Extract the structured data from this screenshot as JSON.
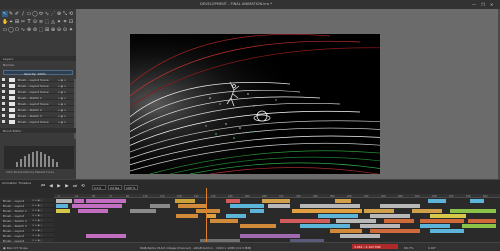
{
  "window": {
    "title": "DEVELOPMENT - FINAL ANIMATION.kra *",
    "controls": [
      "—",
      "❐",
      "✕"
    ]
  },
  "toolbox": {
    "rows": [
      [
        "↖",
        "✎",
        "✐",
        "∕",
        "▭",
        "◯",
        "⬭",
        "∿",
        "⋰",
        "⊕",
        "⤡",
        "⟲"
      ],
      [
        "✋",
        "⌖",
        "⊞",
        "✂",
        "T",
        "⊙",
        "≋",
        "⬚",
        "◬",
        "✦",
        "⌗",
        "⊡"
      ],
      [
        "▭",
        "◯",
        "⬠",
        "∿",
        "⊗",
        "⊘",
        "⬚",
        "⊞",
        "⊕",
        "⊖",
        "⊙",
        "✦"
      ]
    ],
    "active_index": 0
  },
  "layers": {
    "panel_title": "Layers",
    "blend_mode": "Normal",
    "selected_layer": "Opacity: 100%",
    "items": [
      {
        "name": "Brush... Layout Scene"
      },
      {
        "name": "Brush... Layout Scene"
      },
      {
        "name": "Brush... Layout Scene"
      },
      {
        "name": "Brush... Sketch 1"
      },
      {
        "name": "Brush... Layout Scene"
      },
      {
        "name": "Brush... Sketch 2"
      },
      {
        "name": "Brush... Sketch 3"
      },
      {
        "name": "Brush... Layout Scene"
      }
    ]
  },
  "brush_panel": {
    "title": "Brush Editor",
    "caption": "Click Stroke Dots by Fastest Curve"
  },
  "timeline": {
    "title": "Animation Timeline",
    "frame_value": "1:14",
    "fps_value": "24 fps",
    "zoom_value": "100 %",
    "transport": [
      "⏮",
      "◀",
      "▶",
      "▶",
      "⏭",
      "⟲"
    ],
    "ruler_ticks": [
      "0",
      "24",
      "48",
      "72",
      "96",
      "120",
      "144",
      "168",
      "192",
      "216",
      "240",
      "264",
      "288",
      "312",
      "336",
      "360",
      "384",
      "408",
      "432",
      "456",
      "480",
      "504",
      "528",
      "552",
      "576",
      "600"
    ],
    "rows": [
      {
        "name": "Brush... Layout"
      },
      {
        "name": "Brush... Layout"
      },
      {
        "name": "Brush... Sketch 1"
      },
      {
        "name": "Brush... Layout"
      },
      {
        "name": "Brush... Sketch 2"
      },
      {
        "name": "Brush... Sketch 3"
      },
      {
        "name": "Brush... Layout"
      },
      {
        "name": "Brush... Layout"
      },
      {
        "name": "Brush... Layout"
      }
    ],
    "row_icons": "⊙ ⌂ ◉ ◇"
  },
  "status": {
    "left": "▣ Pencil 5 Slope",
    "center": "RGB/Alpha (8-bit integer/channel) · sRGB built-in · 1920 x 1080 (14.3 MiB)",
    "memory": "3,961 / 2,102 MiB",
    "zoom": "66.7%",
    "rotation": "0.00°"
  },
  "colors": {
    "accent": "#2f5f86",
    "canvas_bg": "#6b6b6b",
    "playhead": "#e0802a",
    "memory_alert": "#b02a2a"
  }
}
